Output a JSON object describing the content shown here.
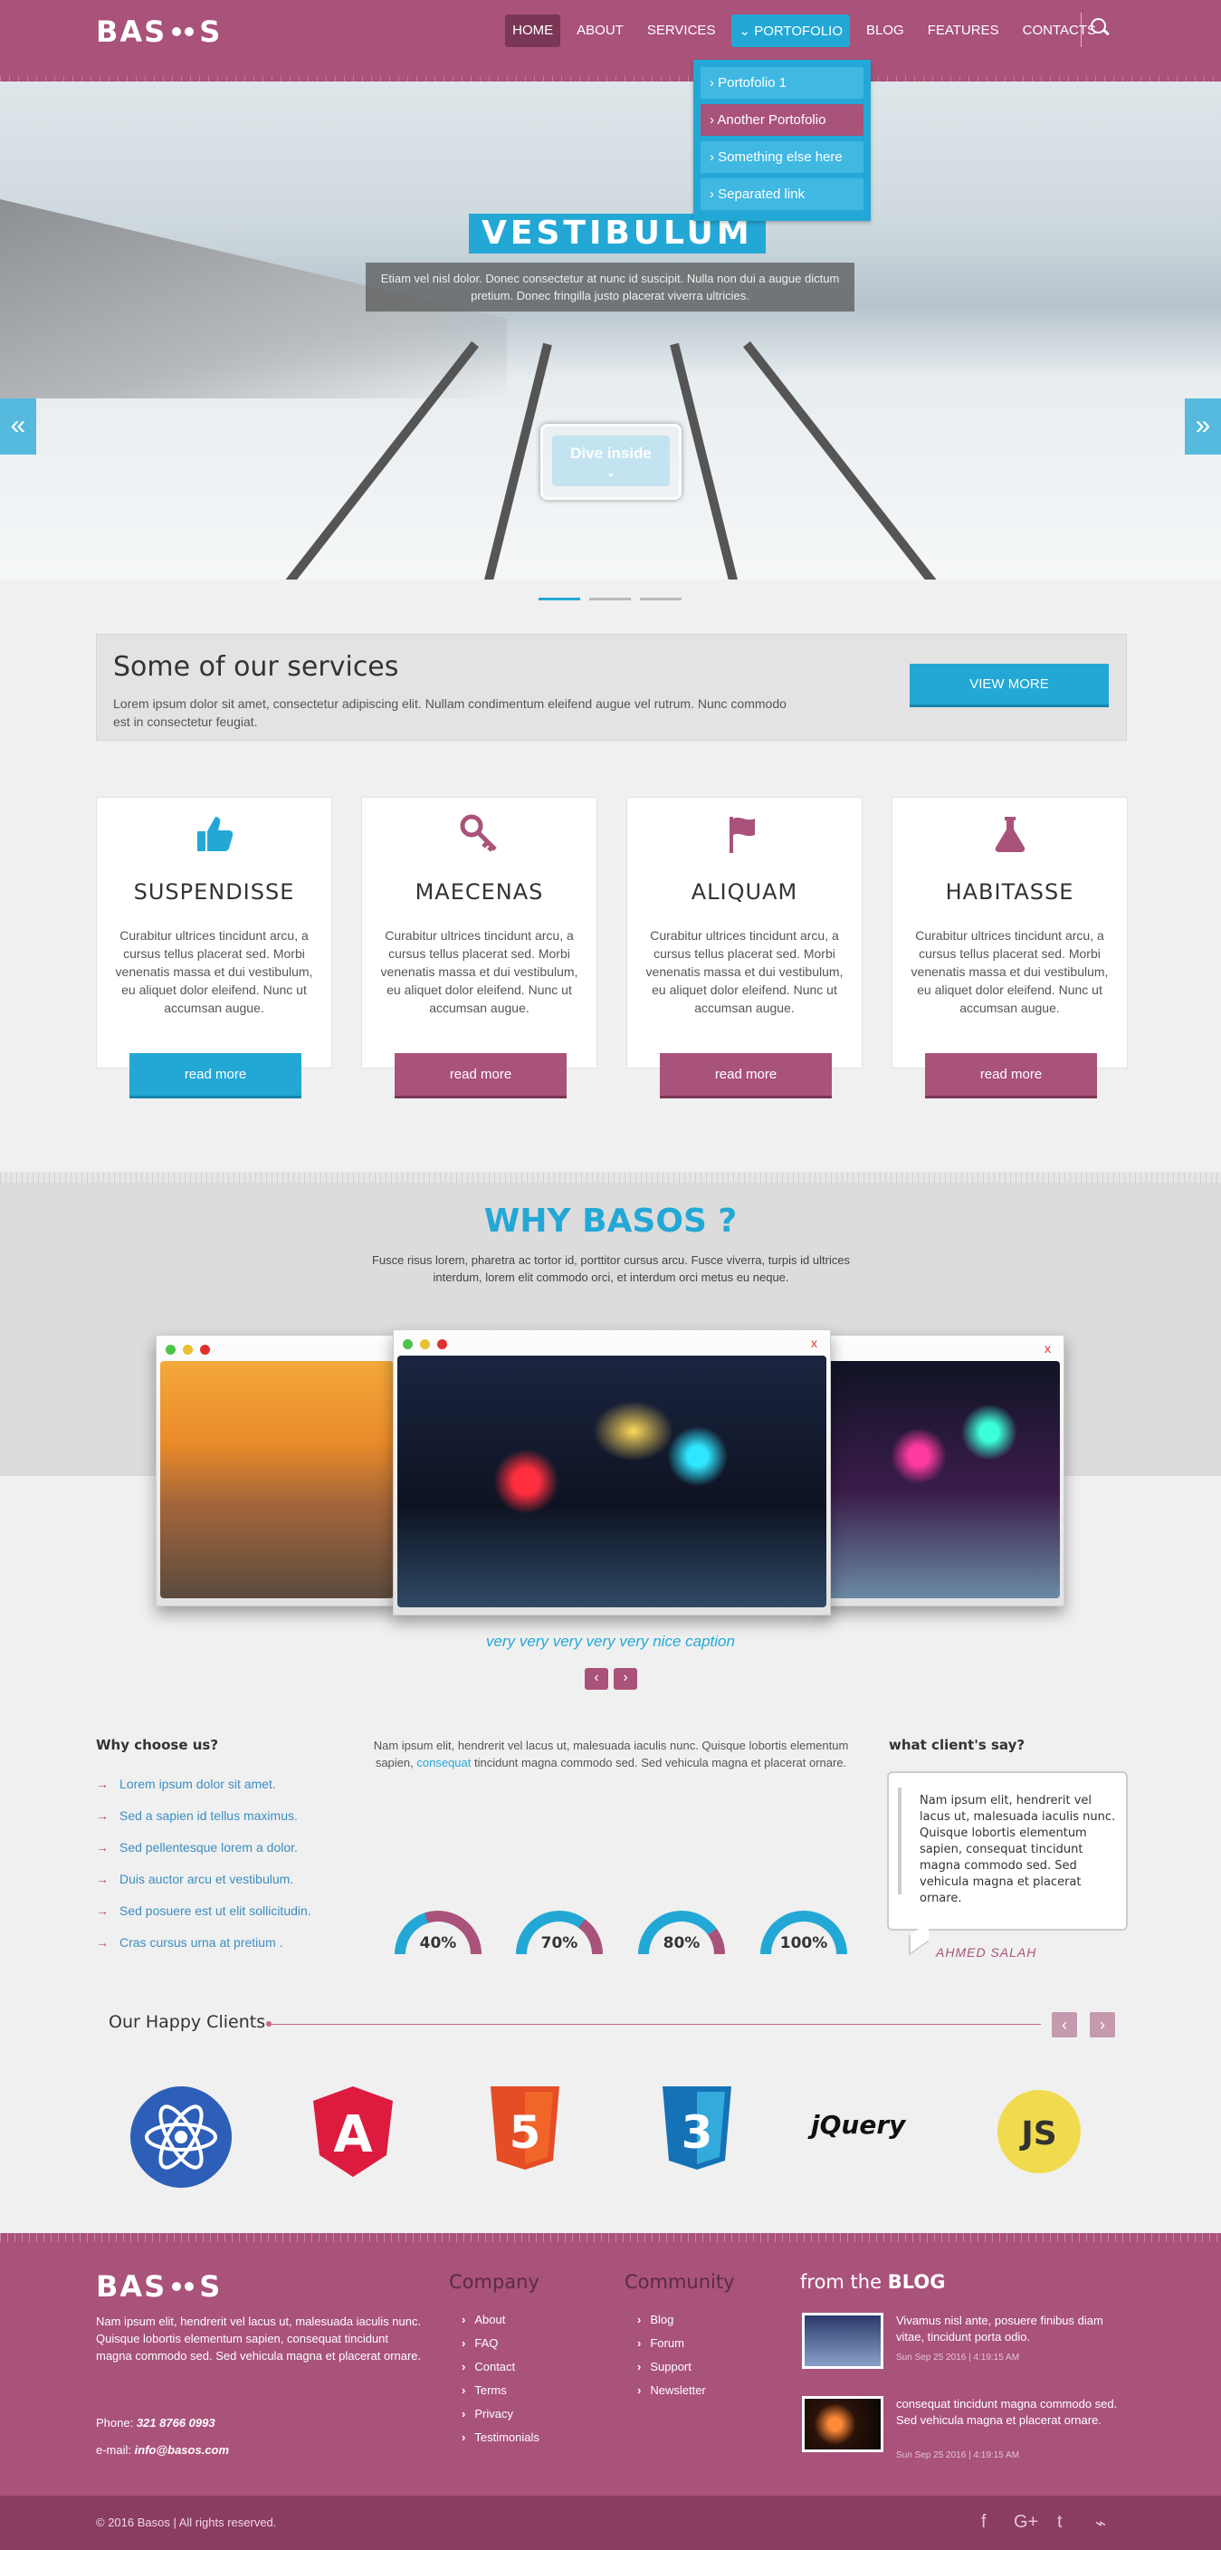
{
  "brand": {
    "logo_left": "BAS",
    "logo_right": "S"
  },
  "nav": {
    "items": [
      "HOME",
      "ABOUT",
      "SERVICES",
      "PORTOFOLIO",
      "BLOG",
      "FEATURES",
      "CONTACTS"
    ],
    "active": "HOME",
    "open": "PORTOFOLIO",
    "open_caret": "⌄"
  },
  "dropdown": {
    "items": [
      "Portofolio 1",
      "Another Portofolio",
      "Something else here",
      "Separated link"
    ],
    "selected": "Another Portofolio"
  },
  "hero": {
    "title": "VESTIBULUM",
    "text": "Etiam vel nisl dolor. Donec consectetur at nunc id suscipit. Nulla non dui a augue dictum pretium. Donec fringilla justo placerat viverra ultricies.",
    "button": "Dive inside",
    "slide_count": 3,
    "active_slide": 1
  },
  "services": {
    "title": "Some of our services",
    "text": "Lorem ipsum dolor sit amet, consectetur adipiscing elit. Nullam condimentum eleifend augue vel rutrum. Nunc commodo est in consectetur feugiat.",
    "button": "VIEW MORE",
    "cards": [
      {
        "title": "SUSPENDISSE",
        "icon": "thumbs-up-icon",
        "text": "Curabitur ultrices tincidunt arcu, a cursus tellus placerat sed. Morbi venenatis massa et dui vestibulum, eu aliquet dolor eleifend. Nunc ut accumsan augue.",
        "button": "read more"
      },
      {
        "title": "MAECENAS",
        "icon": "key-icon",
        "text": "Curabitur ultrices tincidunt arcu, a cursus tellus placerat sed. Morbi venenatis massa et dui vestibulum, eu aliquet dolor eleifend. Nunc ut accumsan augue.",
        "button": "read more"
      },
      {
        "title": "ALIQUAM",
        "icon": "flag-icon",
        "text": "Curabitur ultrices tincidunt arcu, a cursus tellus placerat sed. Morbi venenatis massa et dui vestibulum, eu aliquet dolor eleifend. Nunc ut accumsan augue.",
        "button": "read more"
      },
      {
        "title": "HABITASSE",
        "icon": "flask-icon",
        "text": "Curabitur ultrices tincidunt arcu, a cursus tellus placerat sed. Morbi venenatis massa et dui vestibulum, eu aliquet dolor eleifend. Nunc ut accumsan augue.",
        "button": "read more"
      }
    ]
  },
  "why": {
    "title": "WHY BASOS ?",
    "subtitle": "Fusce risus lorem, pharetra ac tortor id, porttitor cursus arcu. Fusce viverra, turpis id ultrices interdum, lorem elit commodo orci, et interdum orci metus eu neque.",
    "caption": "very very very very very nice caption",
    "window_close": "x"
  },
  "choose": {
    "title": "Why choose us?",
    "items": [
      "Lorem ipsum dolor sit amet.",
      "Sed a sapien id tellus maximus.",
      "Sed pellentesque lorem a dolor.",
      "Duis auctor arcu et vestibulum.",
      "Sed posuere est ut elit sollicitudin.",
      "Cras cursus urna at pretium ."
    ]
  },
  "middle": {
    "text_before": "Nam ipsum elit, hendrerit vel lacus ut, malesuada iaculis nunc. Quisque lobortis elementum sapien, ",
    "link": "consequat",
    "text_after": " tincidunt magna commodo sed. Sed vehicula magna et placerat ornare.",
    "gauges": [
      {
        "label": "40%",
        "value": 40
      },
      {
        "label": "70%",
        "value": 70
      },
      {
        "label": "80%",
        "value": 80
      },
      {
        "label": "100%",
        "value": 100
      }
    ]
  },
  "testimonial": {
    "title": "what client's say?",
    "text": "Nam ipsum elit, hendrerit vel lacus ut, malesuada iaculis nunc. Quisque lobortis elementum sapien, consequat tincidunt magna commodo sed. Sed vehicula magna et placerat ornare.",
    "author": "AHMED SALAH"
  },
  "clients": {
    "title": "Our Happy Clients",
    "logos": [
      "react-logo-icon",
      "angular-logo-icon",
      "html5-logo-icon",
      "css3-logo-icon",
      "jquery-logo-icon",
      "javascript-logo-icon"
    ],
    "logo_text": {
      "angular": "A",
      "html5": "5",
      "css3": "3",
      "jquery": "jQuery",
      "js": "JS"
    }
  },
  "footer": {
    "about": "Nam ipsum elit, hendrerit vel lacus ut, malesuada iaculis nunc. Quisque lobortis elementum sapien, consequat tincidunt magna commodo sed. Sed vehicula magna et placerat ornare.",
    "phone_label": "Phone:",
    "phone": "321 8766 0993",
    "email_label": "e-mail:",
    "email": "info@basos.com",
    "company": {
      "title": "Company",
      "links": [
        "About",
        "FAQ",
        "Contact",
        "Terms",
        "Privacy",
        "Testimonials"
      ]
    },
    "community": {
      "title": "Community",
      "links": [
        "Blog",
        "Forum",
        "Support",
        "Newsletter"
      ]
    },
    "blog": {
      "title_prefix": "from the",
      "title_bold": "BLOG",
      "posts": [
        {
          "text": "Vivamus nisl ante, posuere finibus diam vitae, tincidunt porta odio.",
          "date": "Sun Sep 25 2016 | 4:19:15 AM"
        },
        {
          "text": "consequat tincidunt magna commodo sed. Sed vehicula magna et placerat ornare.",
          "date": "Sun Sep 25 2016 | 4:19:15 AM"
        }
      ]
    },
    "copyright": "© 2016 Basos | All rights reserved.",
    "social": [
      "facebook-icon",
      "google-plus-icon",
      "twitter-icon",
      "rss-icon"
    ],
    "social_glyphs": [
      "f",
      "G+",
      "t",
      "⌁"
    ]
  },
  "colors": {
    "brand": "#a9527a",
    "accent": "#23a8d6",
    "dark_brand": "#7a3655"
  }
}
